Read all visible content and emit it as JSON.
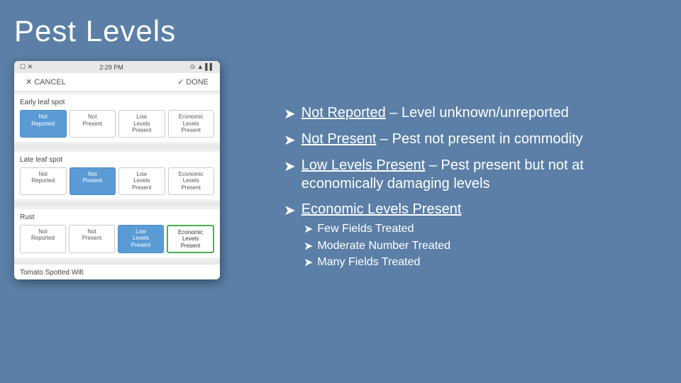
{
  "title": "Pest Levels",
  "phone": {
    "status_bar": {
      "left_icons": "☐ ✕",
      "time": "2:29 PM",
      "right_icons": "⊙ ▲ ▌▌"
    },
    "cancel_label": "CANCEL",
    "done_label": "DONE",
    "sections": [
      {
        "label": "Early leaf spot",
        "options": [
          {
            "text": "Not\nReported",
            "state": "selected-blue"
          },
          {
            "text": "Not\nPresent",
            "state": "normal"
          },
          {
            "text": "Low\nLevels\nPresent",
            "state": "normal"
          },
          {
            "text": "Economic\nLevels\nPresent",
            "state": "normal"
          }
        ]
      },
      {
        "label": "Late leaf spot",
        "options": [
          {
            "text": "Not\nReporte",
            "state": "normal"
          },
          {
            "text": "Not\nPresent",
            "state": "selected-blue"
          },
          {
            "text": "Low\nLevels\nPresent",
            "state": "normal"
          },
          {
            "text": "Economic\nLevels\nPresent",
            "state": "normal"
          }
        ]
      },
      {
        "label": "Rust",
        "options": [
          {
            "text": "Not\nReported",
            "state": "normal"
          },
          {
            "text": "Not\nPresent",
            "state": "normal"
          },
          {
            "text": "Low\nLevels\nPresent",
            "state": "selected-blue"
          },
          {
            "text": "Economic\nLevels\nPresent",
            "state": "selected-outline"
          }
        ]
      }
    ],
    "bottom_label": "Tomato Spotted Wilt"
  },
  "bullets": [
    {
      "key": "not-reported",
      "label_underline": "Not Reported",
      "label_rest": " – Level unknown/unreported"
    },
    {
      "key": "not-present",
      "label_underline": "Not Present",
      "label_rest": " – Pest not present in commodity"
    },
    {
      "key": "low-levels",
      "label_underline": "Low Levels Present",
      "label_rest": " – Pest present but not at economically damaging levels"
    },
    {
      "key": "economic",
      "label_underline": "Economic Levels Present",
      "label_rest": "",
      "sub_bullets": [
        {
          "text": "Few Fields Treated"
        },
        {
          "text": "Moderate Number Treated"
        },
        {
          "text": "Many Fields Treated"
        }
      ]
    }
  ]
}
